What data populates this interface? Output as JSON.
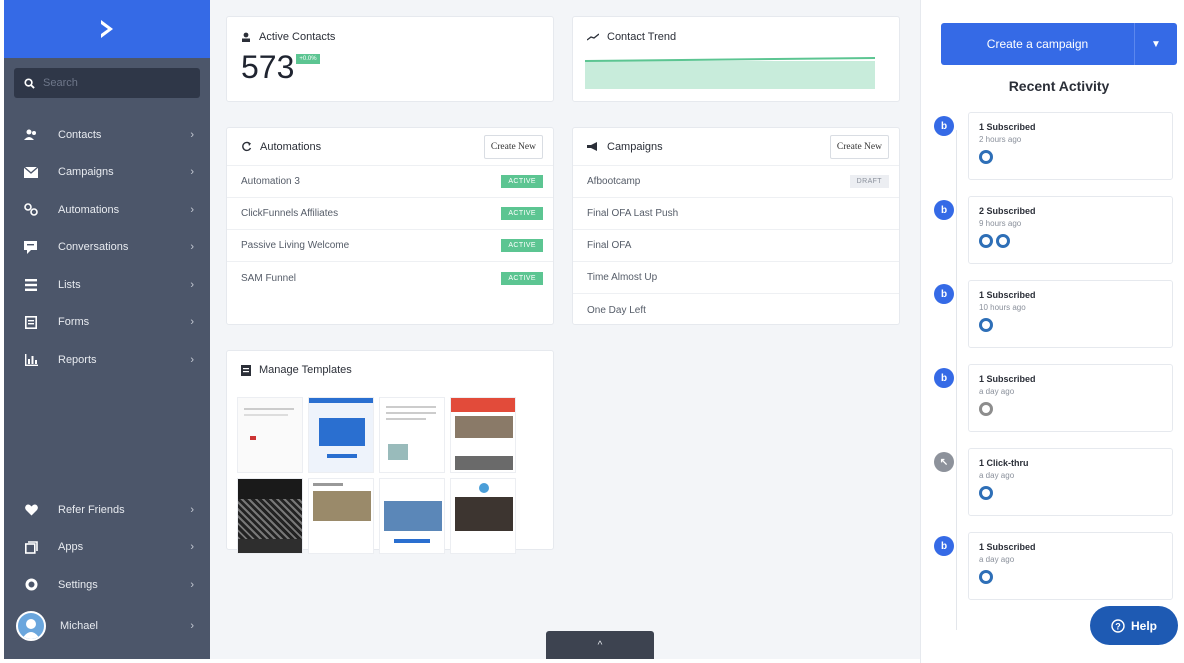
{
  "search": {
    "placeholder": "Search"
  },
  "sidebar": {
    "items": [
      {
        "label": "Contacts",
        "icon": "contacts-icon"
      },
      {
        "label": "Campaigns",
        "icon": "campaigns-icon"
      },
      {
        "label": "Automations",
        "icon": "automations-icon"
      },
      {
        "label": "Conversations",
        "icon": "conversations-icon"
      },
      {
        "label": "Lists",
        "icon": "lists-icon"
      },
      {
        "label": "Forms",
        "icon": "forms-icon"
      },
      {
        "label": "Reports",
        "icon": "reports-icon"
      }
    ],
    "bottom": [
      {
        "label": "Refer Friends",
        "icon": "heart-icon"
      },
      {
        "label": "Apps",
        "icon": "apps-icon"
      },
      {
        "label": "Settings",
        "icon": "gear-icon"
      },
      {
        "label": "Michael",
        "icon": "avatar"
      }
    ]
  },
  "active_contacts": {
    "title": "Active Contacts",
    "count": "573",
    "badge": "+0.0%"
  },
  "contact_trend": {
    "title": "Contact Trend"
  },
  "automations": {
    "title": "Automations",
    "create_label": "Create New",
    "rows": [
      {
        "name": "Automation 3",
        "status": "ACTIVE"
      },
      {
        "name": "ClickFunnels Affiliates",
        "status": "ACTIVE"
      },
      {
        "name": "Passive Living Welcome",
        "status": "ACTIVE"
      },
      {
        "name": "SAM Funnel",
        "status": "ACTIVE"
      }
    ]
  },
  "campaigns": {
    "title": "Campaigns",
    "create_label": "Create New",
    "rows": [
      {
        "name": "Afbootcamp",
        "status": "DRAFT"
      },
      {
        "name": "Final OFA Last Push",
        "status": ""
      },
      {
        "name": "Final OFA",
        "status": ""
      },
      {
        "name": "Time Almost Up",
        "status": ""
      },
      {
        "name": "One Day Left",
        "status": ""
      }
    ]
  },
  "templates": {
    "title": "Manage Templates"
  },
  "right": {
    "cta_label": "Create a campaign",
    "recent_title": "Recent Activity",
    "activities": [
      {
        "title": "1 Subscribed",
        "time": "2 hours ago",
        "faces": 1
      },
      {
        "title": "2 Subscribed",
        "time": "9 hours ago",
        "faces": 2
      },
      {
        "title": "1 Subscribed",
        "time": "10 hours ago",
        "faces": 1
      },
      {
        "title": "1 Subscribed",
        "time": "a day ago",
        "faces": 1
      },
      {
        "title": "1 Click-thru",
        "time": "a day ago",
        "faces": 1
      },
      {
        "title": "1 Subscribed",
        "time": "a day ago",
        "faces": 1
      }
    ]
  },
  "help_label": "Help",
  "colors": {
    "brand": "#356ae6",
    "sidebar": "#4c566a",
    "active": "#5cc592",
    "help": "#1e5ab3"
  }
}
